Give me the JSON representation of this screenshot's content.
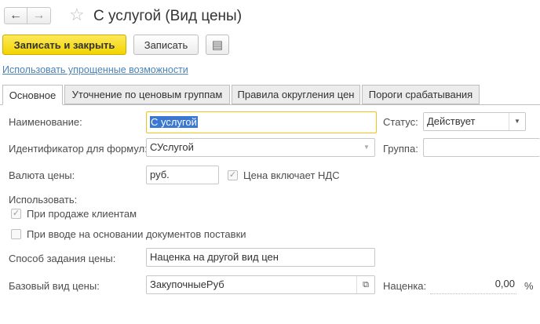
{
  "header": {
    "back_icon": "←",
    "forward_icon": "→",
    "favorite_icon": "☆",
    "title": "С услугой (Вид цены)"
  },
  "toolbar": {
    "write_close_label": "Записать и закрыть",
    "write_label": "Записать",
    "more_icon": "▤"
  },
  "simplified_link": "Использовать упрощенные возможности",
  "tabs": [
    {
      "label": "Основное",
      "active": true
    },
    {
      "label": "Уточнение по ценовым группам",
      "active": false
    },
    {
      "label": "Правила округления цен",
      "active": false
    },
    {
      "label": "Пороги срабатывания",
      "active": false
    }
  ],
  "form": {
    "name_label": "Наименование:",
    "name_value": "С услугой",
    "status_label": "Статус:",
    "status_value": "Действует",
    "formula_id_label": "Идентификатор для формул:",
    "formula_id_value": "СУслугой",
    "group_label": "Группа:",
    "group_value": "",
    "currency_label": "Валюта цены:",
    "currency_value": "руб.",
    "includes_vat_label": "Цена включает НДС",
    "includes_vat_checked": true,
    "use_label": "Использовать:",
    "sale_label": "При продаже клиентам",
    "sale_checked": true,
    "supply_label": "При вводе на основании документов поставки",
    "supply_checked": false,
    "method_label": "Способ задания цены:",
    "method_value": "Наценка на другой вид цен",
    "base_label": "Базовый вид цены:",
    "base_value": "ЗакупочныеРуб",
    "markup_label": "Наценка:",
    "markup_value": "0,00",
    "percent_sign": "%"
  },
  "colors": {
    "primary_button": "#f2d400",
    "focus_border": "#f0c419",
    "link": "#4a82b8",
    "selection": "#3b78d3"
  }
}
